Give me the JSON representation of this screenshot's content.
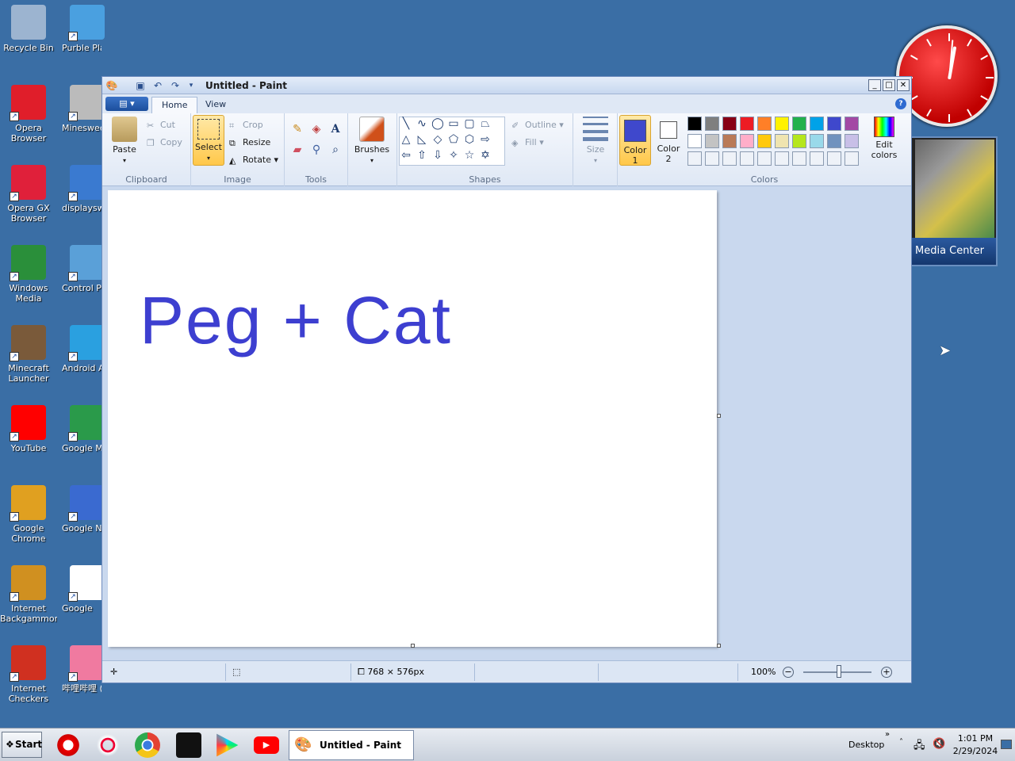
{
  "desktop": {
    "icons": [
      {
        "label": "Recycle Bin",
        "icon": "recycle-bin-icon"
      },
      {
        "label": "Purble Place",
        "icon": "purble-place-icon"
      },
      {
        "label": "Opera Browser",
        "icon": "opera-icon"
      },
      {
        "label": "Minesweeper",
        "icon": "minesweeper-icon"
      },
      {
        "label": "Opera GX Browser",
        "icon": "opera-gx-icon"
      },
      {
        "label": "displayswitch",
        "icon": "display-switch-icon"
      },
      {
        "label": "Windows Media Center",
        "icon": "media-center-icon"
      },
      {
        "label": "Control Panel",
        "icon": "control-panel-icon"
      },
      {
        "label": "Minecraft Launcher",
        "icon": "minecraft-icon"
      },
      {
        "label": "Android Apps on Google Play",
        "icon": "google-play-icon"
      },
      {
        "label": "YouTube",
        "icon": "youtube-icon"
      },
      {
        "label": "Google Maps",
        "icon": "google-maps-icon"
      },
      {
        "label": "Google Chrome",
        "icon": "chrome-icon"
      },
      {
        "label": "Google News",
        "icon": "google-news-icon"
      },
      {
        "label": "Internet Backgammon",
        "icon": "backgammon-icon"
      },
      {
        "label": "Google",
        "icon": "google-icon"
      },
      {
        "label": "Internet Checkers",
        "icon": "checkers-icon"
      },
      {
        "label": "哔哩哔哩 (゜-゜)つロ 干...",
        "icon": "bilibili-icon"
      }
    ],
    "media_center_gadget_label": "Media Center"
  },
  "paint": {
    "title": "Untitled - Paint",
    "tabs": [
      "Home",
      "View"
    ],
    "clipboard": {
      "paste": "Paste",
      "cut": "Cut",
      "copy": "Copy",
      "group": "Clipboard"
    },
    "image": {
      "select": "Select",
      "crop": "Crop",
      "resize": "Resize",
      "rotate": "Rotate",
      "group": "Image"
    },
    "tools": {
      "group": "Tools"
    },
    "brushes": {
      "label": "Brushes"
    },
    "shapes": {
      "outline": "Outline",
      "fill": "Fill",
      "group": "Shapes"
    },
    "size": {
      "label": "Size"
    },
    "colors": {
      "color1": "Color 1",
      "color2": "Color 2",
      "edit": "Edit colors",
      "group": "Colors",
      "color1_value": "#3f48cc",
      "color2_value": "#ffffff",
      "palette_row1": [
        "#000000",
        "#7f7f7f",
        "#880015",
        "#ed1c24",
        "#ff7f27",
        "#fff200",
        "#22b14c",
        "#00a2e8",
        "#3f48cc",
        "#a349a4"
      ],
      "palette_row2": [
        "#ffffff",
        "#c3c3c3",
        "#b97a57",
        "#ffaec9",
        "#ffc90e",
        "#efe4b0",
        "#b5e61d",
        "#99d9ea",
        "#7092be",
        "#c8bfe7"
      ]
    },
    "canvas_text": "Peg + Cat",
    "canvas_text_color": "#3d3fd0",
    "status": {
      "dimensions": "768 × 576px",
      "zoom": "100%"
    }
  },
  "taskbar": {
    "start": "Start",
    "active_window": "Untitled - Paint",
    "desktop_label": "Desktop",
    "time": "1:01 PM",
    "date": "2/29/2024"
  }
}
